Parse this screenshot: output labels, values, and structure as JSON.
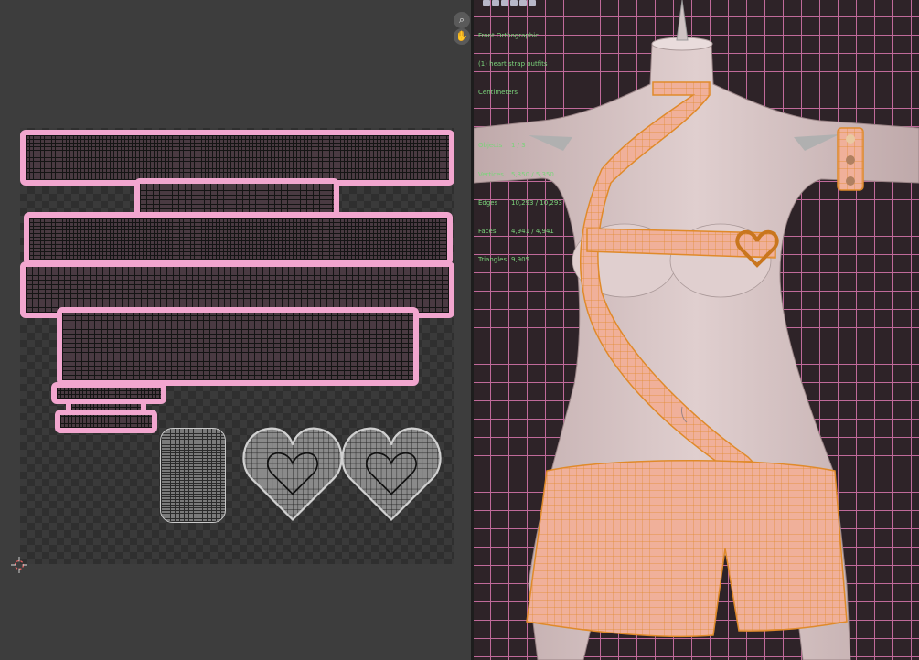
{
  "uv_editor": {
    "tools": [
      {
        "icon": "zoom-icon",
        "glyph": "⌕"
      },
      {
        "icon": "hand-pan-icon",
        "glyph": "✋"
      }
    ]
  },
  "viewport": {
    "view_name": "Front Orthographic",
    "object_name": "(1) heart strap outfits",
    "units": "Centimeters",
    "stats": [
      {
        "label": "Objects",
        "value": "1 / 3"
      },
      {
        "label": "Vertices",
        "value": "5,350 / 5,350"
      },
      {
        "label": "Edges",
        "value": "10,293 / 10,293"
      },
      {
        "label": "Faces",
        "value": "4,941 / 4,941"
      },
      {
        "label": "Triangles",
        "value": "9,905"
      }
    ],
    "colors": {
      "grid": "#c06a9a",
      "background": "#2e2328",
      "skin": "#d8c6c6",
      "cloth": "#f0b09a",
      "wire": "#e08a2a",
      "uv_border": "#f2a6cf",
      "stats_text": "#7bd37b"
    }
  }
}
